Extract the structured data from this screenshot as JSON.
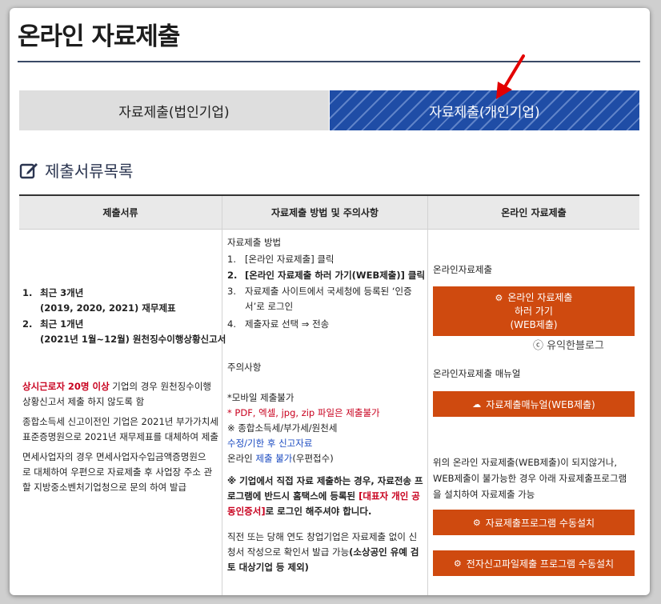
{
  "page": {
    "title": "온라인 자료제출",
    "tabs": [
      {
        "label": "자료제출(법인기업)"
      },
      {
        "label": "자료제출(개인기업)"
      }
    ],
    "section_title": "제출서류목록"
  },
  "table": {
    "headers": [
      "제출서류",
      "자료제출 방법 및 주의사항",
      "온라인 자료제출"
    ],
    "col1": {
      "items": [
        {
          "num": "1.",
          "line1": "최근 3개년",
          "line2": "(2019, 2020, 2021) 재무제표"
        },
        {
          "num": "2.",
          "line1": "최근 1개년",
          "line2": "(2021년 1월~12월) 원천징수이행상황신고서"
        }
      ],
      "note_red": "상시근로자 20명 이상",
      "note_rest": " 기업의 경우 원천징수이행",
      "note_line2": "상황신고서 제출 하지 않도록 함",
      "p2_line1": "종합소득세 신고이전인 기업은 2021년 부가가치세",
      "p2_line2": "표준증명원으로 2021년 재무제표를 대체하여 제출",
      "p3_line1": "면세사업자의 경우 면세사업자수입금액증명원으",
      "p3_line2": "로 대체하여 우편으로 자료제출 후 사업장 주소 관",
      "p3_line3": "할 지방중소벤처기업청으로 문의 하여 발급"
    },
    "col2": {
      "method_title": "자료제출 방법",
      "steps": [
        {
          "num": "1.",
          "line1": "[온라인 자료제출] 클릭",
          "line2": ""
        },
        {
          "num": "2.",
          "line1": "[온라인 자료제출 하러 가기(WEB제출)] 클릭",
          "line2": ""
        },
        {
          "num": "3.",
          "line1": "자료제출 사이트에서 국세청에 등록된 ‘인증",
          "line2": "서’로 로그인"
        },
        {
          "num": "4.",
          "line1": "제출자료 선택 ⇒ 전송",
          "line2": ""
        }
      ],
      "caution_title": "주의사항",
      "mobile_title": "*모바일 제출불가",
      "mobile_red": "* PDF, 엑셀, jpg, zip 파일은 제출불가",
      "tax_line": "※ 종합소득세/부가세/원천세",
      "tax_blue": "수정/기한 후 신고자료",
      "online_prefix": "온라인 ",
      "online_blue": "제출 불가",
      "online_suffix": "(우편접수)",
      "direct_line1": "※ 기업에서 직접 자료 제출하는 경우, 자료전송 프",
      "direct_line2_a": "로그램에 반드시 홈택스에 등록된 ",
      "direct_line2_red": "[대표자 개인 공",
      "direct_line3_red": "동인증서]",
      "direct_line3_b": "로 로그인 해주셔야 합니다.",
      "startup_line1": "직전 또는 당해 연도 창업기업은 자료제출 없이 신",
      "startup_line2_a": "청서 작성으로 확인서 발급 가능",
      "startup_line2_b": "(소상공인 유예 검",
      "startup_line3": "토 대상기업 등 제외)"
    },
    "col3": {
      "online_label": "온라인자료제출",
      "btn_main_line1": "온라인 자료제출",
      "btn_main_line2": "하러 가기",
      "btn_main_line3": "(WEB제출)",
      "watermark": "ⓒ 유익한블로그",
      "manual_label": "온라인자료제출 매뉴얼",
      "btn_manual": "자료제출매뉴얼(WEB제출)",
      "fallback_line1": "위의 온라인 자료제출(WEB제출)이 되지않거나,",
      "fallback_line2": "WEB제출이 불가능한 경우 아래 자료제출프로그램",
      "fallback_line3": "을 설치하여 자료제출 가능",
      "btn_install1": "자료제출프로그램 수동설치",
      "btn_install2": "전자신고파일제출 프로그램 수동설치"
    }
  },
  "colors": {
    "accent_blue": "#1f4da6",
    "button_orange": "#cf4a0f",
    "alert_red": "#c8001e"
  },
  "icons": [
    "edit-icon",
    "gear-icon",
    "cloud-download-icon",
    "arrow-pointer-icon"
  ]
}
